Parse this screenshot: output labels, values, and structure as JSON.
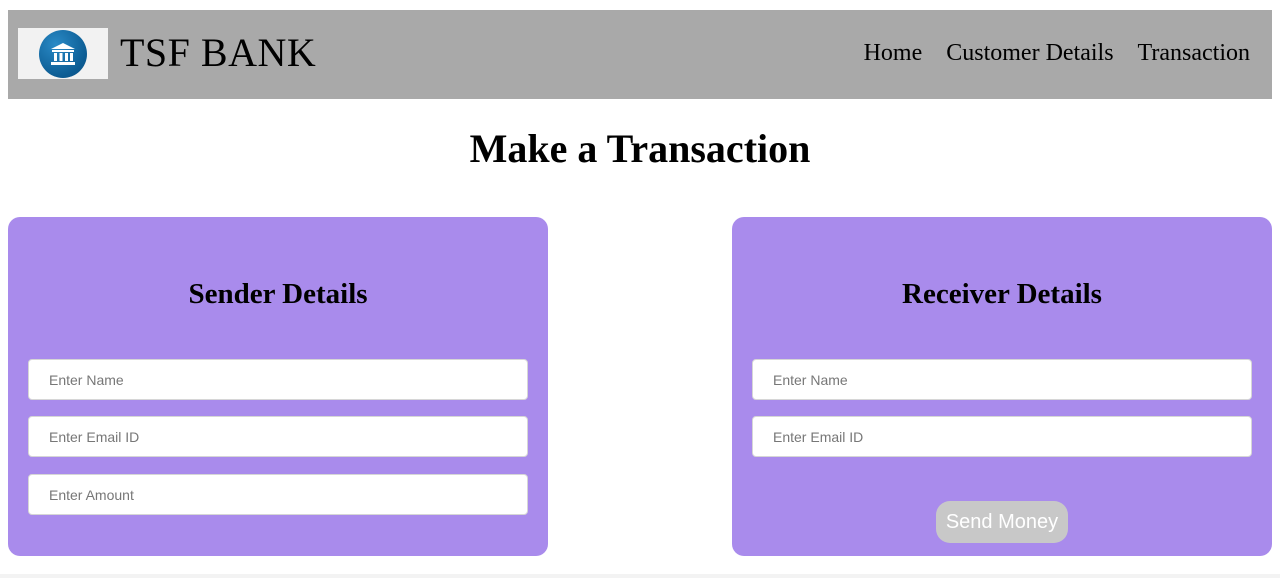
{
  "header": {
    "brand": "TSF BANK",
    "logo_icon": "bank-building-icon",
    "nav": {
      "home": "Home",
      "customer_details": "Customer Details",
      "transaction": "Transaction"
    },
    "bg_color": "#a9a9a9"
  },
  "main": {
    "title": "Make a Transaction"
  },
  "sender": {
    "title": "Sender Details",
    "name_placeholder": "Enter Name",
    "email_placeholder": "Enter Email ID",
    "amount_placeholder": "Enter Amount",
    "name_value": "",
    "email_value": "",
    "amount_value": ""
  },
  "receiver": {
    "title": "Receiver Details",
    "name_placeholder": "Enter Name",
    "email_placeholder": "Enter Email ID",
    "name_value": "",
    "email_value": "",
    "send_label": "Send Money"
  },
  "colors": {
    "card": "#a98bec",
    "button": "#c8c8c8"
  }
}
